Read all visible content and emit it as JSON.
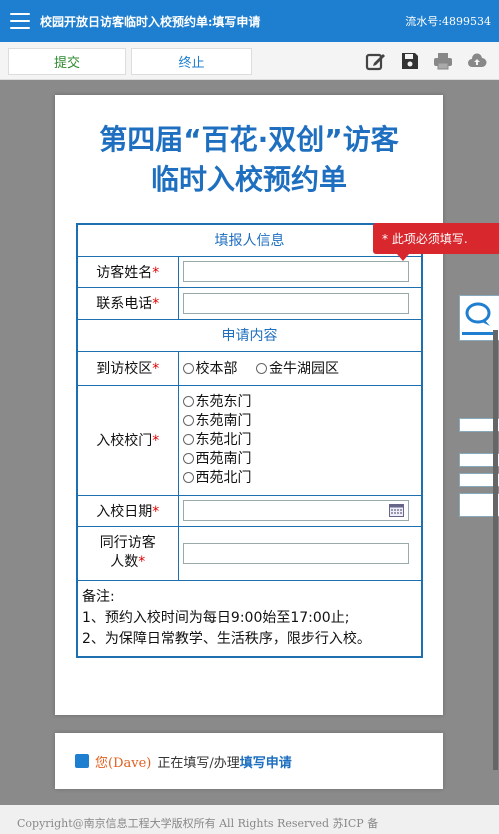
{
  "header": {
    "title": "校园开放日访客临时入校预约单:填写申请",
    "serial": "流水号:4899534"
  },
  "toolbar": {
    "submit_label": "提交",
    "stop_label": "终止",
    "icons": [
      "edit-icon",
      "save-icon",
      "print-icon",
      "cloud-upload-icon"
    ]
  },
  "form": {
    "headline_line1": "第四届“百花·双创”访客",
    "headline_line2": "临时入校预约单",
    "section1": "填报人信息",
    "name_label": "访客姓名",
    "name_value": "",
    "phone_label": "联系电话",
    "phone_value": "",
    "section2": "申请内容",
    "campus_label": "到访校区",
    "campus_options": [
      "校本部",
      "金牛湖园区"
    ],
    "gate_label": "入校校门",
    "gate_options": [
      "东苑东门",
      "东苑南门",
      "东苑北门",
      "西苑南门",
      "西苑北门"
    ],
    "date_label": "入校日期",
    "date_value": "",
    "companions_label_1": "同行访客",
    "companions_label_2": "人数",
    "companions_value": "",
    "required_mark": "*",
    "note_title": "备注:",
    "note_1": "1、预约入校时间为每日9:00始至17:00止;",
    "note_2": "2、为保障日常教学、生活秩序，限步行入校。"
  },
  "tooltip": "* 此项必须填写.",
  "status": {
    "user": "您(Dave)",
    "text": "正在填写/办理",
    "action": "填写申请"
  },
  "footer": "Copyright@南京信息工程大学版权所有 All Rights Reserved   苏ICP 备",
  "colors": {
    "topbar": "#1e7fd0",
    "headline": "#1e6fc0",
    "required": "#dd0000",
    "tooltip": "#d9272e"
  }
}
